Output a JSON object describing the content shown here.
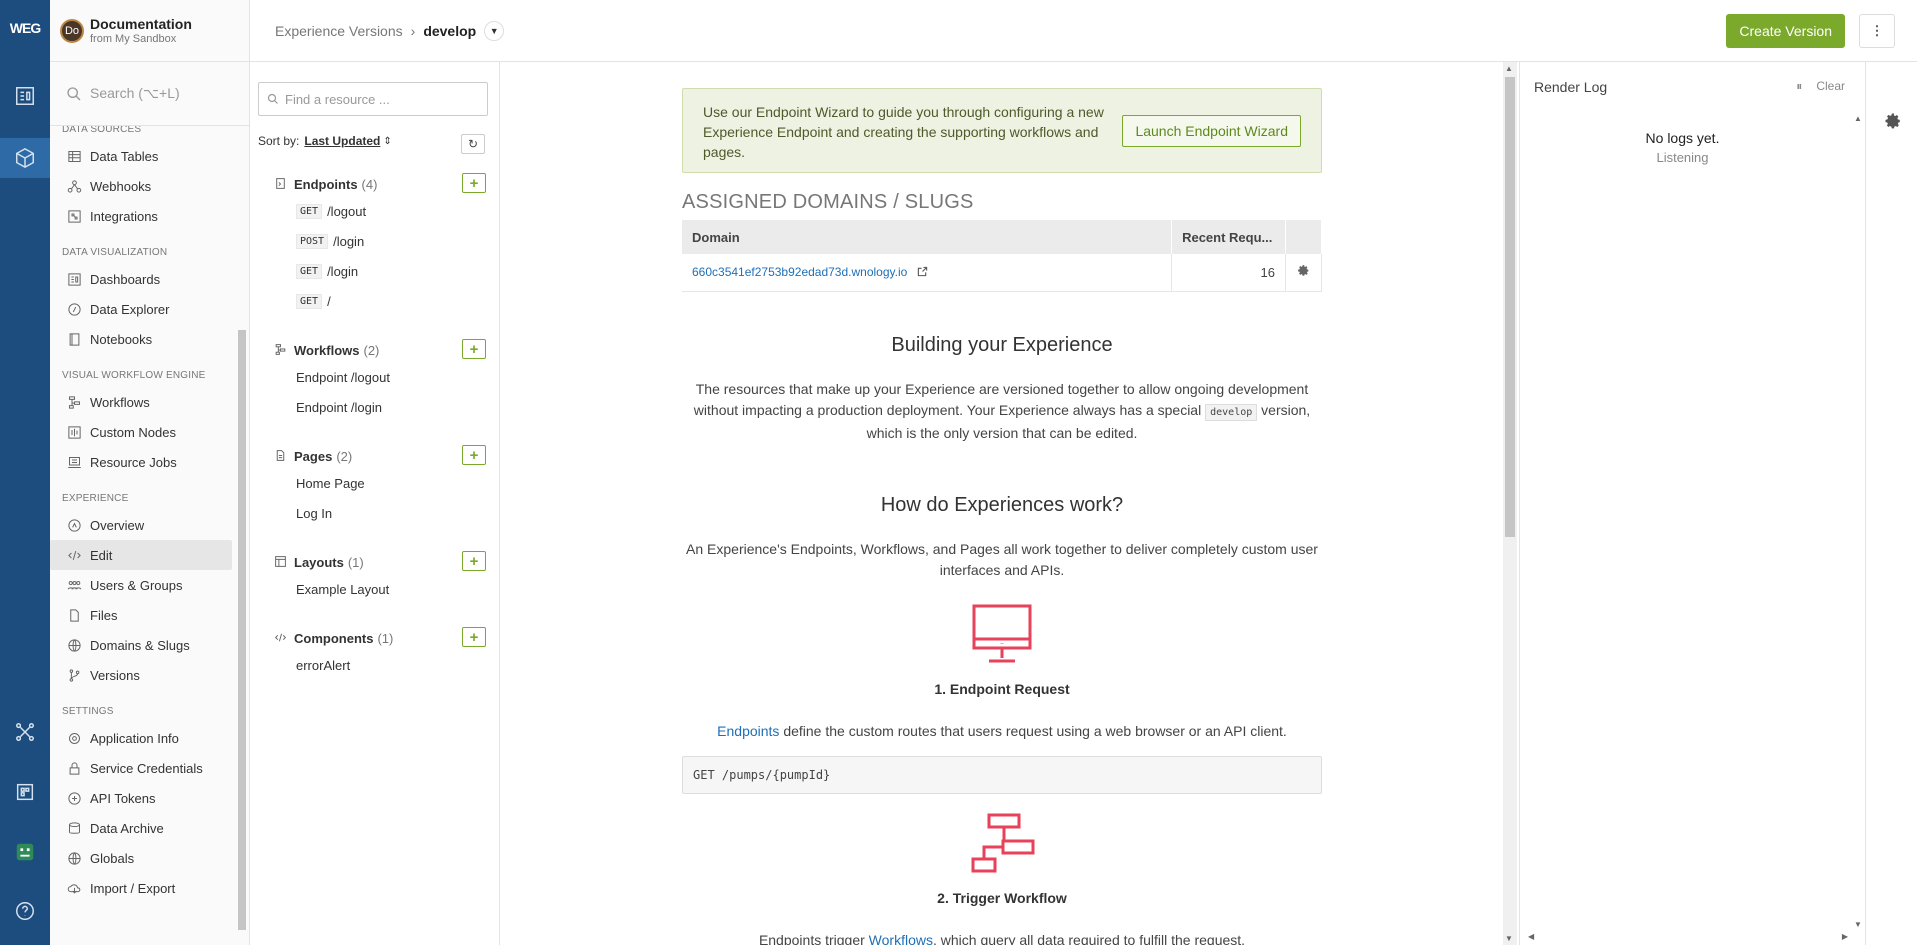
{
  "rail": {
    "logo": "WEG"
  },
  "nav": {
    "app_avatar": "Do",
    "app_title": "Documentation",
    "app_subtitle": "from My Sandbox",
    "search_placeholder": "Search (⌥+L)",
    "sections": [
      {
        "title": "DATA SOURCES",
        "items": [
          "Data Tables",
          "Webhooks",
          "Integrations"
        ]
      },
      {
        "title": "DATA VISUALIZATION",
        "items": [
          "Dashboards",
          "Data Explorer",
          "Notebooks"
        ]
      },
      {
        "title": "VISUAL WORKFLOW ENGINE",
        "items": [
          "Workflows",
          "Custom Nodes",
          "Resource Jobs"
        ]
      },
      {
        "title": "EXPERIENCE",
        "items": [
          "Overview",
          "Edit",
          "Users & Groups",
          "Files",
          "Domains & Slugs",
          "Versions"
        ]
      },
      {
        "title": "SETTINGS",
        "items": [
          "Application Info",
          "Service Credentials",
          "API Tokens",
          "Data Archive",
          "Globals",
          "Import / Export"
        ]
      }
    ],
    "active_item": "Edit"
  },
  "topbar": {
    "crumb_parent": "Experience Versions",
    "crumb_sep": "›",
    "crumb_current": "develop",
    "create_label": "Create Version",
    "more_label": "⋮"
  },
  "tree": {
    "find_placeholder": "Find a resource ...",
    "sort_label": "Sort by:",
    "sort_value": "Last Updated",
    "groups": {
      "endpoints": {
        "label": "Endpoints",
        "count": "(4)",
        "items": [
          {
            "method": "GET",
            "path": "/logout"
          },
          {
            "method": "POST",
            "path": "/login"
          },
          {
            "method": "GET",
            "path": "/login"
          },
          {
            "method": "GET",
            "path": "/"
          }
        ]
      },
      "workflows": {
        "label": "Workflows",
        "count": "(2)",
        "items": [
          "Endpoint /logout",
          "Endpoint /login"
        ]
      },
      "pages": {
        "label": "Pages",
        "count": "(2)",
        "items": [
          "Home Page",
          "Log In"
        ]
      },
      "layouts": {
        "label": "Layouts",
        "count": "(1)",
        "items": [
          "Example Layout"
        ]
      },
      "components": {
        "label": "Components",
        "count": "(1)",
        "items": [
          "errorAlert"
        ]
      }
    }
  },
  "main": {
    "wizard_text": "Use our Endpoint Wizard to guide you through configuring a new Experience Endpoint and creating the supporting workflows and pages.",
    "wizard_button": "Launch Endpoint Wizard",
    "domains_title": "ASSIGNED DOMAINS / SLUGS",
    "table_headers": [
      "Domain",
      "Recent Requ..."
    ],
    "table_rows": [
      {
        "domain": "660c3541ef2753b92edad73d.wnology.io",
        "requests": "16"
      }
    ],
    "building_title": "Building your Experience",
    "building_text_1": "The resources that make up your Experience are versioned together to allow ongoing development without impacting a production deployment. Your Experience always has a special",
    "building_code": "develop",
    "building_text_2": "version, which is the only version that can be edited.",
    "how_title": "How do Experiences work?",
    "how_text": "An Experience's Endpoints, Workflows, and Pages all work together to deliver completely custom user interfaces and APIs.",
    "step1_title": "1. Endpoint Request",
    "step1_link": "Endpoints",
    "step1_text": "define the custom routes that users request using a web browser or an API client.",
    "step1_code": "GET /pumps/{pumpId}",
    "step2_title": "2. Trigger Workflow",
    "step2_pre": "Endpoints trigger",
    "step2_link": "Workflows",
    "step2_text": ", which query all data required to fulfill the request."
  },
  "log": {
    "title": "Render Log",
    "pause_label": "⏸",
    "clear_label": "Clear",
    "empty_title": "No logs yet.",
    "empty_sub": "Listening"
  },
  "colors": {
    "accent": "#7aa92b",
    "rail": "#1d4c7e",
    "link": "#1e6fb7",
    "icon_red": "#e8415a"
  }
}
